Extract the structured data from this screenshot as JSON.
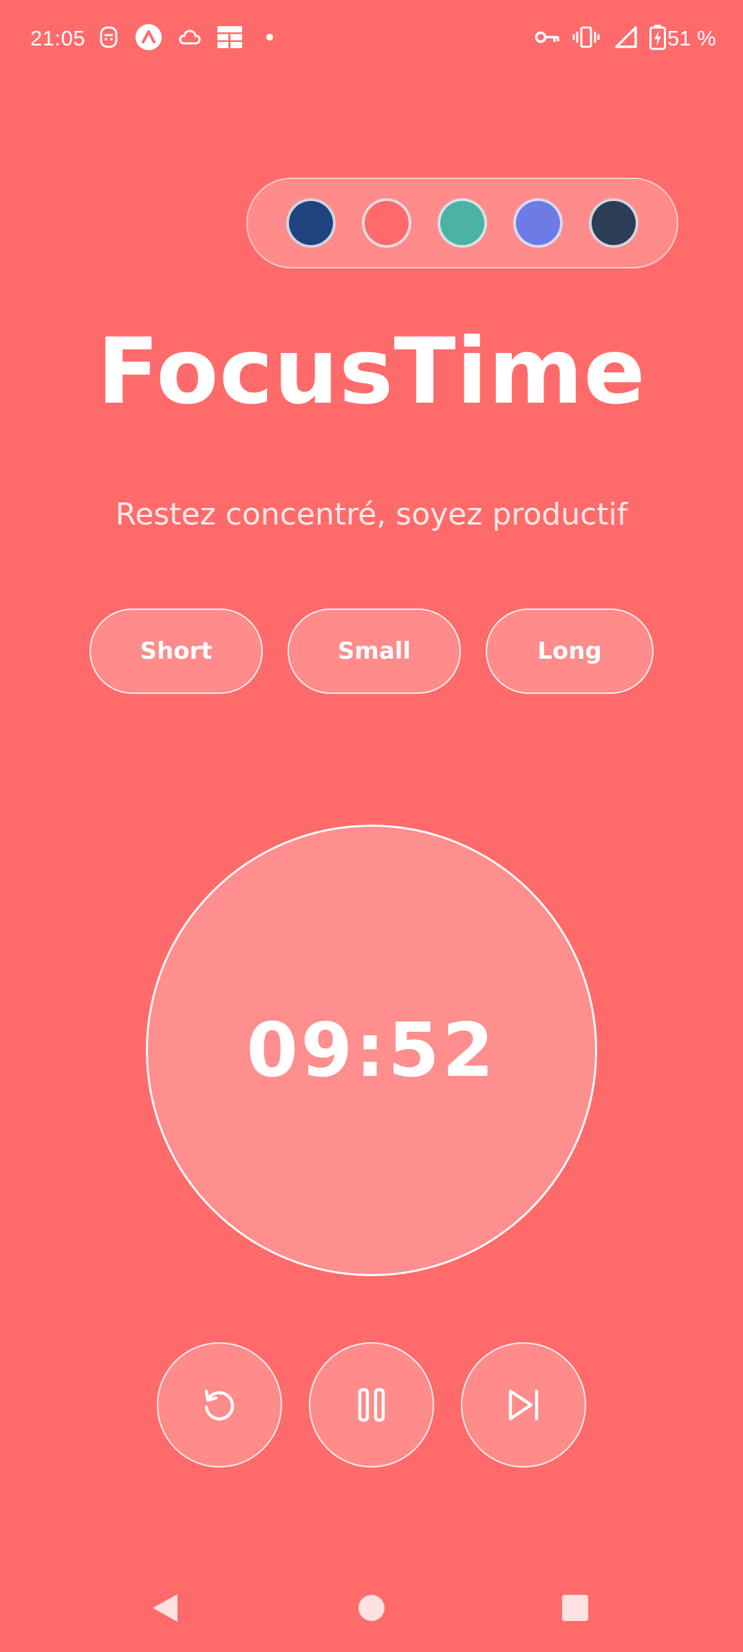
{
  "status_bar": {
    "time": "21:05",
    "battery_text": "51 %",
    "left_icons": [
      "face-icon",
      "a-logo-icon",
      "cloud-icon",
      "grid-icon",
      "dot-icon"
    ],
    "right_icons": [
      "key-icon",
      "vibrate-icon",
      "signal-icon",
      "battery-charging-icon"
    ]
  },
  "theme_picker": {
    "swatches": [
      {
        "name": "navy",
        "color": "#1F4480"
      },
      {
        "name": "coral",
        "color": "#FF6B6B",
        "selected": true
      },
      {
        "name": "teal",
        "color": "#4AB3A4"
      },
      {
        "name": "periwinkle",
        "color": "#6C7BE5"
      },
      {
        "name": "slate",
        "color": "#2C3E55"
      }
    ]
  },
  "header": {
    "title": "FocusTime",
    "subtitle": "Restez concentré, soyez productif"
  },
  "modes": [
    {
      "label": "Short"
    },
    {
      "label": "Small"
    },
    {
      "label": "Long"
    }
  ],
  "timer": {
    "display": "09:52"
  },
  "controls": [
    {
      "icon": "reset-icon"
    },
    {
      "icon": "pause-icon"
    },
    {
      "icon": "skip-next-icon"
    }
  ],
  "nav": {
    "icons": [
      "back-icon",
      "home-icon",
      "recents-icon"
    ]
  },
  "colors": {
    "background": "#FF6B6B",
    "timer_fill": "#FF8E8E",
    "text": "#FFFFFF"
  }
}
